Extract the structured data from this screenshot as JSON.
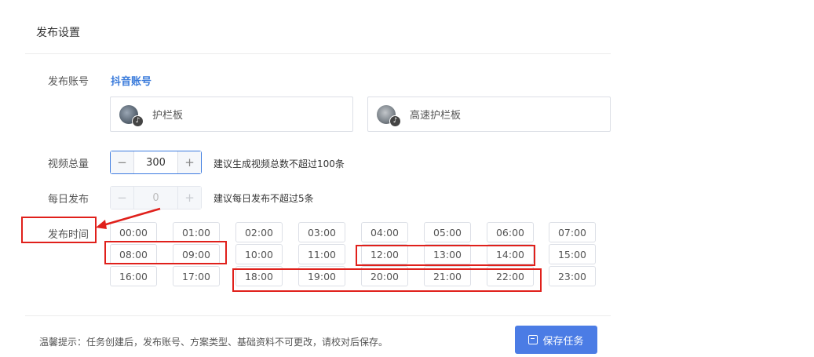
{
  "section_title": "发布设置",
  "form": {
    "account_label": "发布账号",
    "account_platform": "抖音账号",
    "accounts": [
      {
        "name": "护栏板",
        "badge": "♪"
      },
      {
        "name": "高速护栏板",
        "badge": "♪"
      }
    ],
    "total_label": "视频总量",
    "total_value": "300",
    "total_hint": "建议生成视频总数不超过100条",
    "daily_label": "每日发布",
    "daily_value": "0",
    "daily_hint": "建议每日发布不超过5条",
    "time_label": "发布时间",
    "minus_sign": "−",
    "plus_sign": "+"
  },
  "times": [
    "00:00",
    "01:00",
    "02:00",
    "03:00",
    "04:00",
    "05:00",
    "06:00",
    "07:00",
    "08:00",
    "09:00",
    "10:00",
    "11:00",
    "12:00",
    "13:00",
    "14:00",
    "15:00",
    "16:00",
    "17:00",
    "18:00",
    "19:00",
    "20:00",
    "21:00",
    "22:00",
    "23:00"
  ],
  "footer": {
    "tip": "温馨提示：任务创建后，发布账号、方案类型、基础资料不可更改，请校对后保存。",
    "save_label": "保存任务"
  },
  "colors": {
    "accent": "#4b7ce5",
    "link": "#3a7bdb",
    "annotation_red": "#e0201b"
  }
}
